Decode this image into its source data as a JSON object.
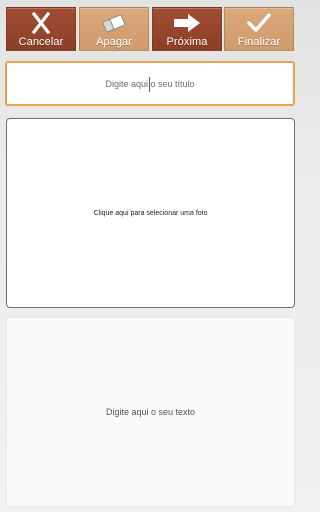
{
  "toolbar": {
    "cancel": {
      "label": "Cancelar",
      "icon": "close-icon",
      "color": "#963f26"
    },
    "erase": {
      "label": "Apagar",
      "icon": "eraser-icon",
      "color": "#d6a072"
    },
    "next": {
      "label": "Próxima",
      "icon": "arrow-right-icon",
      "color": "#963f26"
    },
    "finish": {
      "label": "Finalizar",
      "icon": "checkmark-icon",
      "color": "#d6a072"
    }
  },
  "title_field": {
    "placeholder": "Digite aqui o seu título",
    "border_color": "#e9a24d"
  },
  "photo_panel": {
    "label": "Clique aqui para selecionar uma foto"
  },
  "text_panel": {
    "label": "Digite aqui o seu texto"
  }
}
